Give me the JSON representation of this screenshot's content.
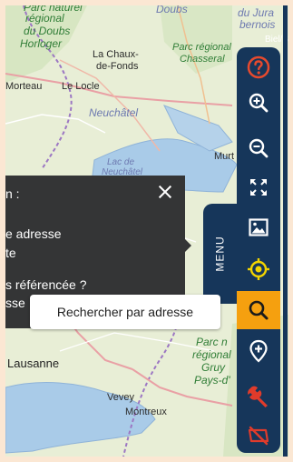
{
  "map": {
    "labels": {
      "top_parc_fragment": "Parc naturel",
      "regional_doubs": "régional",
      "du_doubs": "du Doubs",
      "horloger": "Horloger",
      "doubs_top": "Doubs",
      "du_jura": "du Jura",
      "bernois": "bernois",
      "biel_fragment": "Biel/B",
      "la_chaux": "La Chaux-",
      "de_fonds": "de-Fonds",
      "parc_regional": "Parc régional",
      "chasseral": "Chasseral",
      "morteau": "Morteau",
      "le_locle": "Le Locle",
      "neuchatel": "Neuchâtel",
      "lac_de": "Lac de",
      "neuchatel_lake": "Neuchâtel",
      "murten_fragment": "Murt",
      "lausanne": "Lausanne",
      "vevey": "Vevey",
      "montreux": "Montreux",
      "parc_n": "Parc n",
      "regional_r": "régional",
      "gruy": "Gruy",
      "pays_d": "Pays-d'"
    }
  },
  "panel": {
    "title_fragment": "n :",
    "line1_fragment": "e adresse",
    "line2_fragment": "te",
    "line3_fragment": "s référencée ?",
    "line4_fragment": "sse"
  },
  "menu_tab": {
    "label": "MENU"
  },
  "toolbar": {
    "tools": [
      {
        "name": "help-tool",
        "icon": "help-icon"
      },
      {
        "name": "zoom-in-tool",
        "icon": "zoom-in-icon"
      },
      {
        "name": "zoom-out-tool",
        "icon": "zoom-out-icon"
      },
      {
        "name": "fullscreen-tool",
        "icon": "fullscreen-icon"
      },
      {
        "name": "basemap-tool",
        "icon": "image-icon"
      },
      {
        "name": "locate-tool",
        "icon": "gps-target-icon"
      },
      {
        "name": "search-tool",
        "icon": "search-icon",
        "active": true
      },
      {
        "name": "add-location-tool",
        "icon": "add-location-icon"
      },
      {
        "name": "tools-tool",
        "icon": "wrench-icon"
      },
      {
        "name": "hide-tool",
        "icon": "eye-off-icon"
      }
    ]
  },
  "tooltip": {
    "text": "Rechercher par adresse"
  },
  "colors": {
    "toolbar_bg": "#16365a",
    "active_tool": "#f5a00f",
    "help_icon": "#e64a2e",
    "locate_icon": "#f2d400",
    "wrench_icon": "#e03b2b",
    "panel_bg": "#343536",
    "page_border": "#fbe7d3"
  }
}
